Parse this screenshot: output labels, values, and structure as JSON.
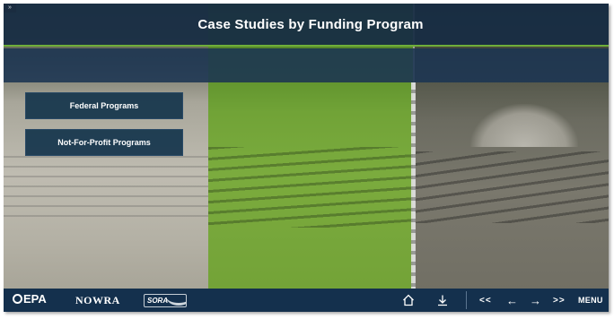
{
  "header": {
    "title": "Case Studies by Funding Program",
    "corner_glyph": "»"
  },
  "programs": [
    {
      "label": "Federal Programs"
    },
    {
      "label": "Not-For-Profit Programs"
    }
  ],
  "footer": {
    "logos": {
      "epa": "EPA",
      "nowra": "NOWRA",
      "sora": "SORA"
    },
    "nav": {
      "home_icon": "home-icon",
      "download_icon": "download-icon",
      "first_label": "<<",
      "back_label": "←",
      "next_label": "→",
      "last_label": ">>",
      "menu_label": "MENU"
    }
  },
  "colors": {
    "header_bg": "#172d44",
    "accent_green": "#6fae3a",
    "button_bg": "#18384e",
    "footer_bg": "#14304d"
  }
}
